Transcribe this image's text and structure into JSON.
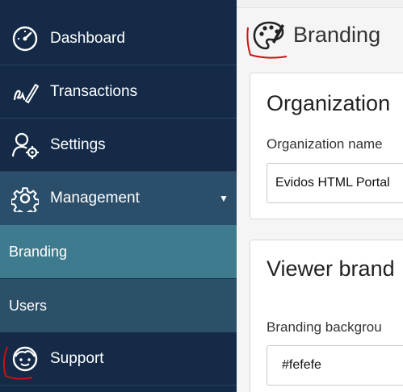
{
  "sidebar": {
    "items": [
      {
        "label": "Dashboard",
        "icon": "dashboard-icon"
      },
      {
        "label": "Transactions",
        "icon": "signature-icon"
      },
      {
        "label": "Settings",
        "icon": "user-settings-icon"
      },
      {
        "label": "Management",
        "icon": "gear-icon",
        "caret": "▼"
      }
    ],
    "subitems": [
      {
        "label": "Branding",
        "active": true
      },
      {
        "label": "Users",
        "active": false
      }
    ],
    "support": {
      "label": "Support",
      "icon": "support-face-icon"
    }
  },
  "main": {
    "title": "Branding",
    "title_icon": "palette-icon",
    "cards": [
      {
        "heading": "Organization",
        "field_label": "Organization name",
        "field_value": "Evidos HTML Portal"
      },
      {
        "heading": "Viewer brand",
        "field_label": "Branding backgrou",
        "field_value": "#fefefe"
      }
    ]
  },
  "colors": {
    "sidebar_bg": "#142a47",
    "management_bg": "#2b4f6b",
    "branding_active_bg": "#3f7b8e",
    "users_bg": "#2b5068",
    "annotation_red": "#cc1111"
  }
}
